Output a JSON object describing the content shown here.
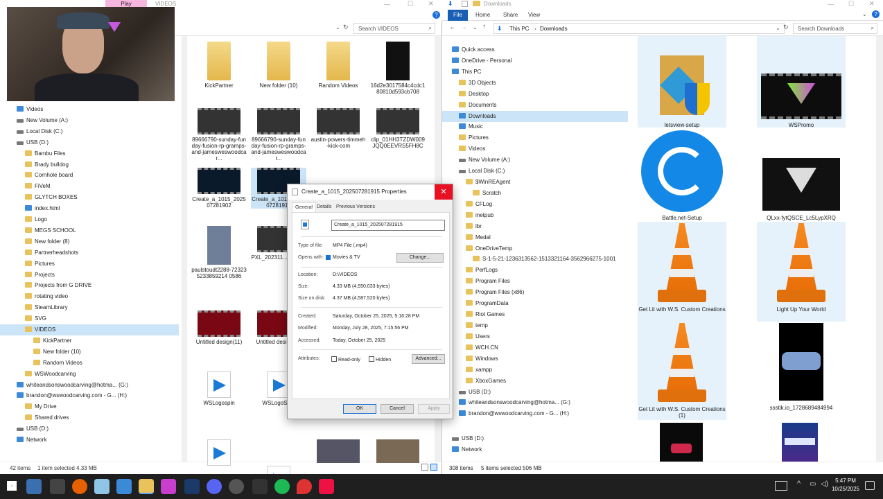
{
  "left_explorer": {
    "tab_labels": [
      "Play",
      "VIDEOS"
    ],
    "search_placeholder": "Search VIDEOS",
    "nav": [
      {
        "label": "Videos",
        "icon": "video-folder-icon",
        "indent": 0
      },
      {
        "label": "New Volume (A:)",
        "icon": "drive-icon",
        "indent": 0
      },
      {
        "label": "Local Disk (C:)",
        "icon": "drive-icon",
        "indent": 0
      },
      {
        "label": "USB (D:)",
        "icon": "drive-icon",
        "indent": 0
      },
      {
        "label": "Bambu Files",
        "icon": "folder-icon",
        "indent": 1
      },
      {
        "label": "Brady bulldog",
        "icon": "folder-icon",
        "indent": 1
      },
      {
        "label": "Cornhole board",
        "icon": "folder-icon",
        "indent": 1
      },
      {
        "label": "FiVeM",
        "icon": "folder-icon",
        "indent": 1
      },
      {
        "label": "GLYTCH BOXES",
        "icon": "folder-icon",
        "indent": 1
      },
      {
        "label": "index.html",
        "icon": "file-icon",
        "indent": 1
      },
      {
        "label": "Logo",
        "icon": "folder-icon",
        "indent": 1
      },
      {
        "label": "MEGS SCHOOL",
        "icon": "folder-icon",
        "indent": 1
      },
      {
        "label": "New folder (8)",
        "icon": "folder-icon",
        "indent": 1
      },
      {
        "label": "Partnerheadshots",
        "icon": "folder-icon",
        "indent": 1
      },
      {
        "label": "Pictures",
        "icon": "folder-icon",
        "indent": 1
      },
      {
        "label": "Projects",
        "icon": "folder-icon",
        "indent": 1
      },
      {
        "label": "Projects from G DRIVE",
        "icon": "folder-icon",
        "indent": 1
      },
      {
        "label": "rotating video",
        "icon": "folder-icon",
        "indent": 1
      },
      {
        "label": "SteamLibrary",
        "icon": "folder-icon",
        "indent": 1
      },
      {
        "label": "SVG",
        "icon": "folder-icon",
        "indent": 1
      },
      {
        "label": "VIDEOS",
        "icon": "folder-icon",
        "indent": 1,
        "selected": true
      },
      {
        "label": "KickPartner",
        "icon": "folder-icon",
        "indent": 2
      },
      {
        "label": "New folder (10)",
        "icon": "folder-icon",
        "indent": 2
      },
      {
        "label": "Random Videos",
        "icon": "folder-icon",
        "indent": 2
      },
      {
        "label": "WSWoodcarving",
        "icon": "folder-icon",
        "indent": 1
      },
      {
        "label": "whiteandsonswoodcarving@hotma... (G:)",
        "icon": "google-drive-icon",
        "indent": 0
      },
      {
        "label": "brandon@wswoodcarving.com - G... (H:)",
        "icon": "google-drive-icon",
        "indent": 0
      },
      {
        "label": "My Drive",
        "icon": "folder-icon",
        "indent": 1
      },
      {
        "label": "Shared drives",
        "icon": "folder-icon",
        "indent": 1
      },
      {
        "label": "USB (D:)",
        "icon": "drive-icon",
        "indent": 0
      },
      {
        "label": "Network",
        "icon": "network-icon",
        "indent": 0
      }
    ],
    "files": [
      {
        "name": "KickPartner",
        "kind": "folder"
      },
      {
        "name": "New folder (10)",
        "kind": "folder"
      },
      {
        "name": "Random Videos",
        "kind": "folder"
      },
      {
        "name": "16d2e3017584c4cdc180810d593cb708",
        "kind": "image"
      },
      {
        "name": "89666790-sunday-funday-fusion-rp-gramps-and-jamesweswoodcar...",
        "kind": "video"
      },
      {
        "name": "89666790-sunday-funday-fusion-rp-gramps-and-jamesweswoodcar...",
        "kind": "video"
      },
      {
        "name": "austin-powers-timmeh-kick-com",
        "kind": "video"
      },
      {
        "name": "clip_01HH3TZDW009JQQ0EEVRS5FH8C",
        "kind": "video"
      },
      {
        "name": "Create_a_1015_202507281902",
        "kind": "video"
      },
      {
        "name": "Create_a_1015_202507281915",
        "kind": "video"
      },
      {
        "name": "paulstoudt2288-723235233859214 0586",
        "kind": "video"
      },
      {
        "name": "PXL_202311...054186",
        "kind": "video"
      },
      {
        "name": "Untitled design(11)",
        "kind": "video"
      },
      {
        "name": "Untitled design(...)",
        "kind": "video"
      },
      {
        "name": "WSLogospin",
        "kind": "video-file"
      },
      {
        "name": "WSLogoSp...",
        "kind": "video-file"
      }
    ],
    "status_count": "42 items",
    "status_selected": "1 item selected  4.33 MB"
  },
  "right_explorer": {
    "title": "Downloads",
    "ribbon_tabs": [
      "File",
      "Home",
      "Share",
      "View"
    ],
    "breadcrumb": [
      "This PC",
      "Downloads"
    ],
    "search_placeholder": "Search Downloads",
    "nav": [
      {
        "label": "Quick access",
        "icon": "star-icon",
        "indent": 0
      },
      {
        "label": "OneDrive - Personal",
        "icon": "cloud-icon",
        "indent": 0
      },
      {
        "label": "This PC",
        "icon": "pc-icon",
        "indent": 0
      },
      {
        "label": "3D Objects",
        "icon": "folder-icon",
        "indent": 1
      },
      {
        "label": "Desktop",
        "icon": "folder-icon",
        "indent": 1
      },
      {
        "label": "Documents",
        "icon": "folder-icon",
        "indent": 1
      },
      {
        "label": "Downloads",
        "icon": "download-icon",
        "indent": 1,
        "selected": true
      },
      {
        "label": "Music",
        "icon": "music-icon",
        "indent": 1
      },
      {
        "label": "Pictures",
        "icon": "folder-icon",
        "indent": 1
      },
      {
        "label": "Videos",
        "icon": "folder-icon",
        "indent": 1
      },
      {
        "label": "New Volume (A:)",
        "icon": "drive-icon",
        "indent": 1
      },
      {
        "label": "Local Disk (C:)",
        "icon": "drive-icon",
        "indent": 1
      },
      {
        "label": "$WinREAgent",
        "icon": "folder-icon",
        "indent": 2
      },
      {
        "label": "Scratch",
        "icon": "folder-icon",
        "indent": 3
      },
      {
        "label": "CFLog",
        "icon": "folder-icon",
        "indent": 2
      },
      {
        "label": "inetpub",
        "icon": "folder-icon",
        "indent": 2
      },
      {
        "label": "lbr",
        "icon": "folder-icon",
        "indent": 2
      },
      {
        "label": "Medal",
        "icon": "folder-icon",
        "indent": 2
      },
      {
        "label": "OneDriveTemp",
        "icon": "folder-icon",
        "indent": 2
      },
      {
        "label": "S-1-5-21-1236313562-1513321164-3562966275-1001",
        "icon": "folder-icon",
        "indent": 3
      },
      {
        "label": "PerfLogs",
        "icon": "folder-icon",
        "indent": 2
      },
      {
        "label": "Program Files",
        "icon": "folder-icon",
        "indent": 2
      },
      {
        "label": "Program Files (x86)",
        "icon": "folder-icon",
        "indent": 2
      },
      {
        "label": "ProgramData",
        "icon": "folder-icon",
        "indent": 2
      },
      {
        "label": "Riot Games",
        "icon": "folder-icon",
        "indent": 2
      },
      {
        "label": "temp",
        "icon": "folder-icon",
        "indent": 2
      },
      {
        "label": "Users",
        "icon": "folder-icon",
        "indent": 2
      },
      {
        "label": "WCH.CN",
        "icon": "folder-icon",
        "indent": 2
      },
      {
        "label": "Windows",
        "icon": "folder-icon",
        "indent": 2
      },
      {
        "label": "xampp",
        "icon": "folder-icon",
        "indent": 2
      },
      {
        "label": "XboxGames",
        "icon": "folder-icon",
        "indent": 2
      },
      {
        "label": "USB (D:)",
        "icon": "drive-icon",
        "indent": 1
      },
      {
        "label": "whiteandsonswoodcarving@hotma... (G:)",
        "icon": "google-drive-icon",
        "indent": 1
      },
      {
        "label": "brandon@wswoodcarving.com - G... (H:)",
        "icon": "google-drive-icon",
        "indent": 1
      },
      {
        "label": "USB (D:)",
        "icon": "drive-icon",
        "indent": 0
      },
      {
        "label": "Network",
        "icon": "network-icon",
        "indent": 0
      }
    ],
    "files": [
      {
        "name": "letsview-setup",
        "kind": "installer"
      },
      {
        "name": "WSPromo",
        "kind": "video"
      },
      {
        "name": "Battle.net-Setup",
        "kind": "battlenet"
      },
      {
        "name": "QLxx-fytQSCE_Lc5LypXRQ",
        "kind": "video"
      },
      {
        "name": "Get Lit with W.S. Custom Creations",
        "kind": "vlc"
      },
      {
        "name": "Light Up Your World",
        "kind": "vlc"
      },
      {
        "name": "Get Lit with W.S. Custom Creations (1)",
        "kind": "vlc"
      },
      {
        "name": "ssstik.io_1728689484994",
        "kind": "video"
      },
      {
        "name": "",
        "kind": "video"
      },
      {
        "name": "",
        "kind": "video"
      }
    ],
    "status_count": "308 items",
    "status_selected": "5 items selected  506 MB"
  },
  "dialog": {
    "title": "Create_a_1015_202507281915 Properties",
    "tabs": [
      "General",
      "Details",
      "Previous Versions"
    ],
    "filename": "Create_a_1015_202507281915",
    "type_label": "Type of file:",
    "type_value": "MP4 File (.mp4)",
    "opens_label": "Opens with:",
    "opens_value": "Movies & TV",
    "change_button": "Change...",
    "location_label": "Location:",
    "location_value": "D:\\VIDEOS",
    "size_label": "Size:",
    "size_value": "4.33 MB (4,550,033 bytes)",
    "size_disk_label": "Size on disk:",
    "size_disk_value": "4.37 MB (4,587,520 bytes)",
    "created_label": "Created:",
    "created_value": "Saturday, October 25, 2025, 5:16:28 PM",
    "modified_label": "Modified:",
    "modified_value": "Monday, July 28, 2025, 7:15:56 PM",
    "accessed_label": "Accessed:",
    "accessed_value": "Today, October 25, 2025",
    "attributes_label": "Attributes:",
    "readonly_label": "Read-only",
    "hidden_label": "Hidden",
    "advanced_button": "Advanced...",
    "ok_button": "OK",
    "cancel_button": "Cancel",
    "apply_button": "Apply"
  },
  "taskbar": {
    "time": "5:47 PM",
    "date": "10/25/2025"
  }
}
